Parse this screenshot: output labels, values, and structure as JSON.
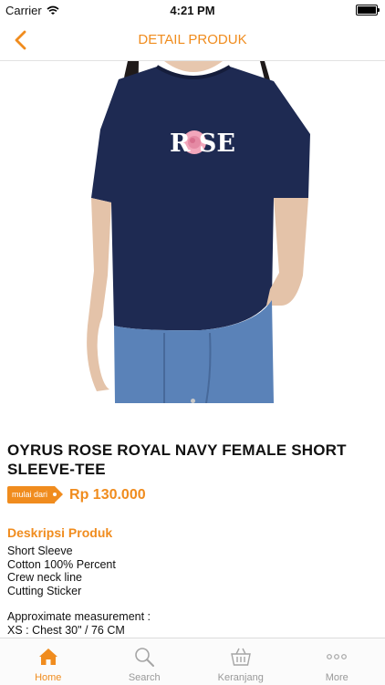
{
  "status_bar": {
    "carrier": "Carrier",
    "time": "4:21 PM"
  },
  "nav": {
    "title": "DETAIL PRODUK"
  },
  "product": {
    "title": "OYRUS ROSE ROYAL NAVY FEMALE SHORT SLEEVE-TEE",
    "price_tag": "mulai dari",
    "price": "Rp 130.000",
    "shirt_text": "R SE",
    "shirt_color": "#1e2a52"
  },
  "description": {
    "heading": "Deskripsi Produk",
    "lines": [
      "Short Sleeve",
      "Cotton 100% Percent",
      "Crew neck line",
      "Cutting Sticker"
    ],
    "measure_lines": [
      "Approximate measurement :",
      "XS : Chest 30\" / 76 CM"
    ]
  },
  "tabs": [
    {
      "label": "Home",
      "icon": "home-icon",
      "active": true
    },
    {
      "label": "Search",
      "icon": "search-icon",
      "active": false
    },
    {
      "label": "Keranjang",
      "icon": "basket-icon",
      "active": false
    },
    {
      "label": "More",
      "icon": "more-icon",
      "active": false
    }
  ],
  "colors": {
    "accent": "#f08c1e",
    "inactive": "#999999"
  }
}
